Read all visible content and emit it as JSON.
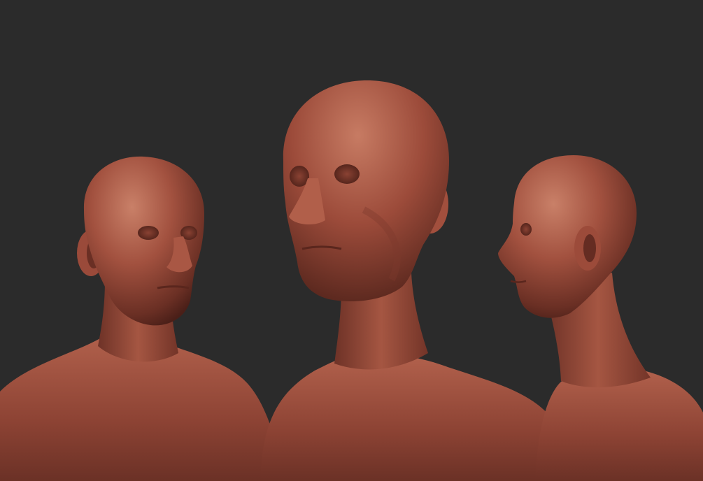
{
  "scene": {
    "background_color": "#2b2b2b",
    "material": {
      "base": "#9a4a3a",
      "highlight": "#c57560",
      "shadow": "#5e2a20",
      "deep_shadow": "#3e1a14"
    },
    "subjects": [
      {
        "name": "bust-three-quarter-left",
        "view": "three-quarter"
      },
      {
        "name": "bust-front-upward",
        "view": "front"
      },
      {
        "name": "bust-profile-left",
        "view": "profile"
      }
    ]
  }
}
